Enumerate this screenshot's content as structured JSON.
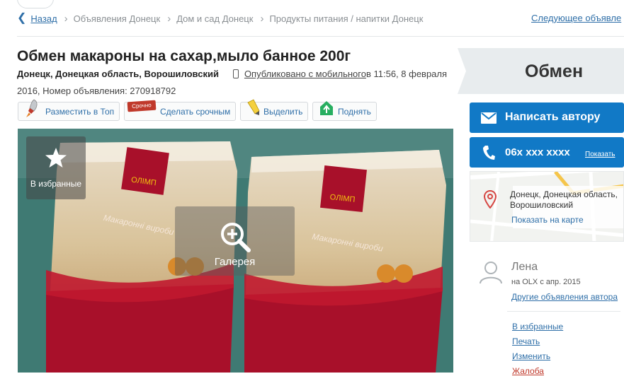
{
  "breadcrumbs": {
    "back": "Назад",
    "items": [
      "Объявления Донецк",
      "Дом и сад Донецк",
      "Продукты питания / напитки Донецк"
    ],
    "next": "Следующее объявле"
  },
  "ad": {
    "title": "Обмен макароны на сахар,мыло банное 200г",
    "location": "Донецк, Донецкая область, Ворошиловский",
    "published_mobile": "Опубликовано с мобильного",
    "published_time": " в 11:56, 8 февраля",
    "published_line2": "2016, Номер объявления: 270918792"
  },
  "actions": {
    "top": "Разместить в Топ",
    "urgent_badge": "Срочно",
    "urgent": "Сделать срочным",
    "highlight": "Выделить",
    "raise": "Поднять"
  },
  "photo": {
    "favorites": "В избранные",
    "gallery": "Галерея",
    "brand": "ОЛІМП",
    "product_text": "Макаронні вироби"
  },
  "sidebar": {
    "price": "Обмен",
    "write": "Написать автору",
    "phone": "06x xxx xxxx",
    "show_phone": "Показать",
    "address": "Донецк, Донецкая область, Ворошиловский",
    "show_map": "Показать на карте",
    "user_name": "Лена",
    "user_since": "на OLX с апр. 2015",
    "other_ads": "Другие объявления автора",
    "links": {
      "favorites": "В избранные",
      "print": "Печать",
      "edit": "Изменить",
      "complaint": "Жалоба"
    }
  },
  "colors": {
    "primary": "#1179c6",
    "link": "#2f6fa8",
    "complaint": "#c0392b",
    "bag_red": "#b0142a"
  },
  "icons": [
    "back-arrow-icon",
    "phone-icon",
    "rocket-icon",
    "urgent-icon",
    "marker-icon",
    "raise-icon",
    "star-icon",
    "zoom-icon",
    "envelope-icon",
    "handset-icon",
    "map-pin-icon",
    "user-icon"
  ]
}
